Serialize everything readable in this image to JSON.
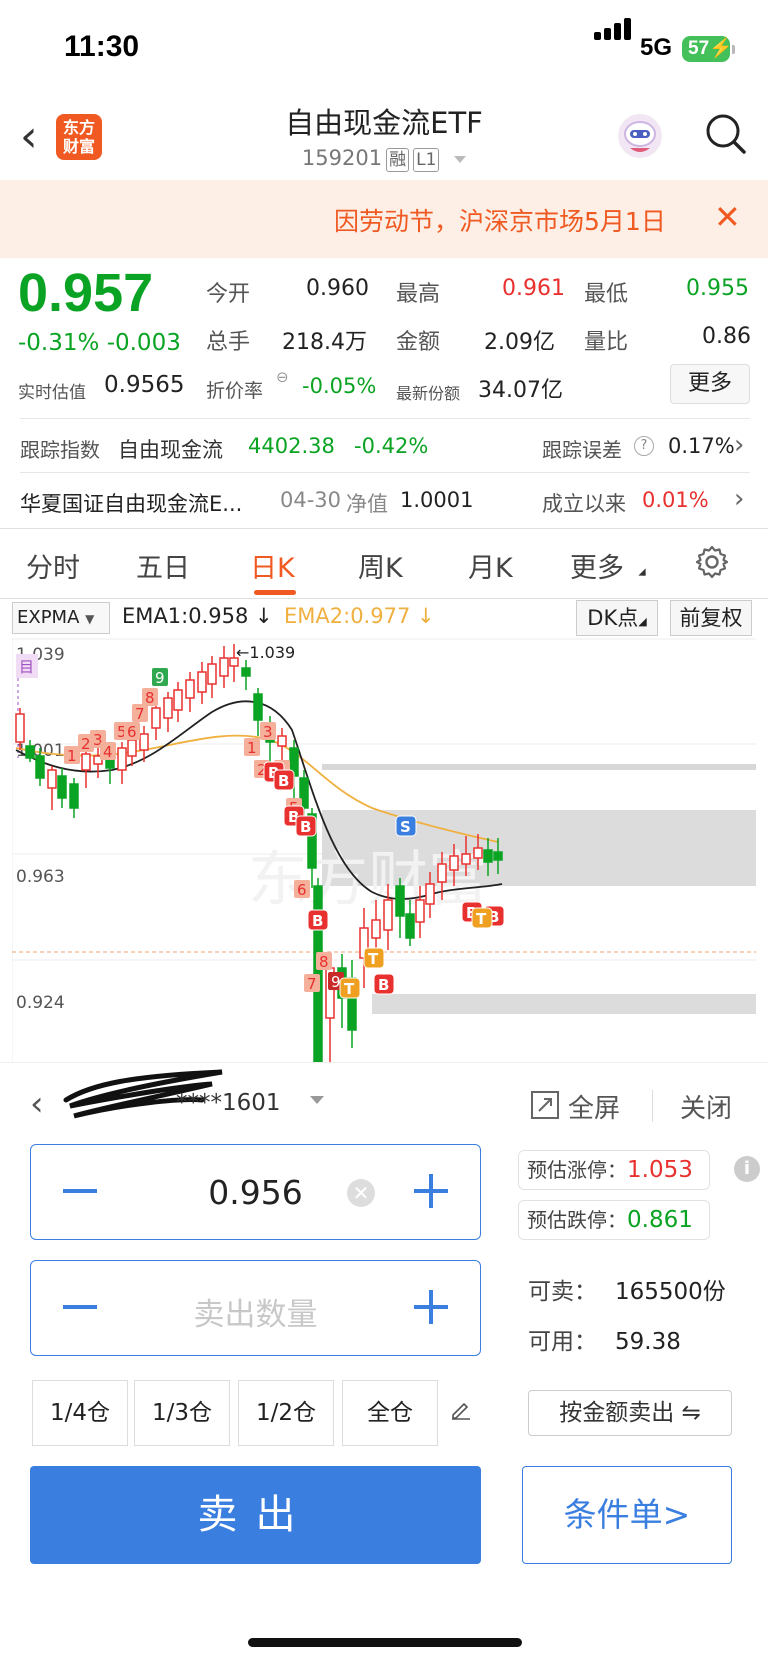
{
  "status": {
    "time": "11:30",
    "network": "5G",
    "battery": "57"
  },
  "header": {
    "logo_line1": "东方",
    "logo_line2": "财富",
    "title": "自由现金流ETF",
    "code": "159201",
    "tag1": "融",
    "tag2": "L1"
  },
  "notice": {
    "text": "因劳动节，沪深京市场5月1日"
  },
  "quote": {
    "price": "0.957",
    "change_pct": "-0.31%",
    "change": "-0.003",
    "open_label": "今开",
    "open": "0.960",
    "high_label": "最高",
    "high": "0.961",
    "low_label": "最低",
    "low": "0.955",
    "volume_label": "总手",
    "volume": "218.4万",
    "amount_label": "金额",
    "amount": "2.09亿",
    "ratio_label": "量比",
    "ratio": "0.86",
    "est_label": "实时估值",
    "est": "0.9565",
    "discount_label": "折价率",
    "discount": "-0.05%",
    "shares_label": "最新份额",
    "shares": "34.07亿",
    "more": "更多"
  },
  "tracking": {
    "label": "跟踪指数",
    "index": "自由现金流",
    "value": "4402.38",
    "pct": "-0.42%",
    "err_label": "跟踪误差",
    "err": "0.17%"
  },
  "fund": {
    "name": "华夏国证自由现金流E...",
    "date": "04-30",
    "nav_label": "净值",
    "nav": "1.0001",
    "since_label": "成立以来",
    "since": "0.01%"
  },
  "tabs": [
    "分时",
    "五日",
    "日K",
    "周K",
    "月K",
    "更多"
  ],
  "indicator": {
    "name": "EXPMA",
    "ema1": "EMA1:0.958",
    "ema2": "EMA2:0.977",
    "dk": "DK点",
    "fq": "前复权"
  },
  "chart_data": {
    "type": "candlestick",
    "y_ticks": [
      "1.039",
      "1.001",
      "0.963",
      "0.924"
    ],
    "high_label": "1.039",
    "current_line": 0.957,
    "watermark": "东方财富"
  },
  "trade": {
    "account": "****1601",
    "fullscreen": "全屏",
    "close": "关闭",
    "price": "0.956",
    "qty_placeholder": "卖出数量",
    "limit_up_label": "预估涨停：",
    "limit_up": "1.053",
    "limit_down_label": "预估跌停：",
    "limit_down": "0.861",
    "sellable_label": "可卖：",
    "sellable": "165500份",
    "available_label": "可用：",
    "available": "59.38",
    "pos": [
      "1/4仓",
      "1/3仓",
      "1/2仓",
      "全仓"
    ],
    "by_amount": "按金额卖出",
    "sell": "卖出",
    "conditional": "条件单>"
  }
}
